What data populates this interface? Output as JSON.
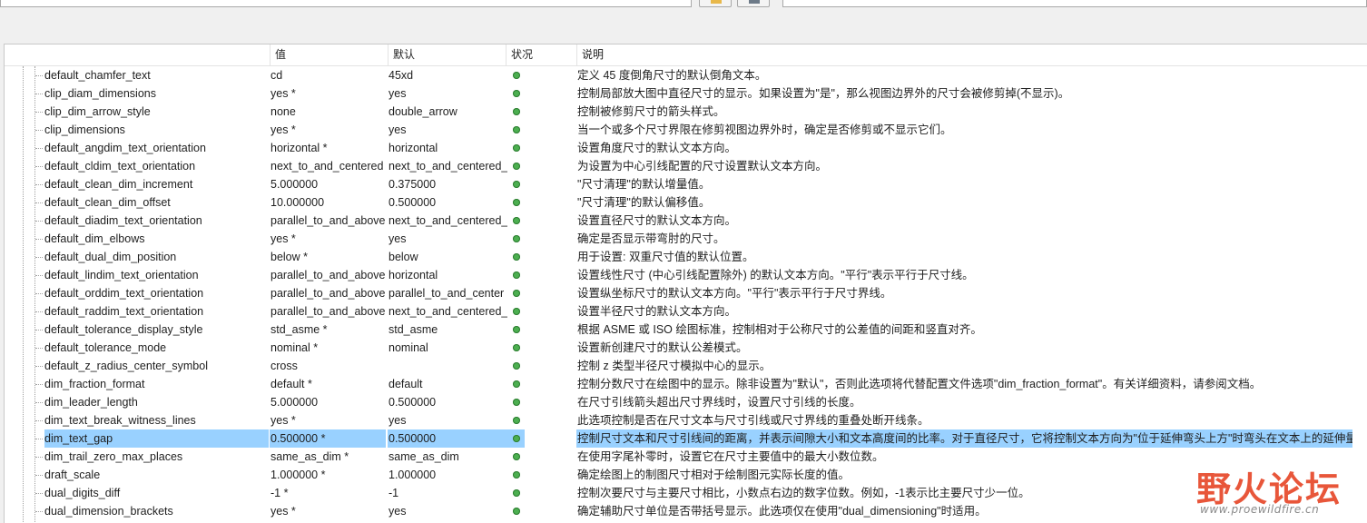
{
  "table": {
    "headers": {
      "name": "",
      "value": "值",
      "default": "默认",
      "status": "状况",
      "description": "说明"
    },
    "rows": [
      {
        "name": "default_chamfer_text",
        "value": "cd",
        "default": "45xd",
        "description": "定义 45 度倒角尺寸的默认倒角文本。"
      },
      {
        "name": "clip_diam_dimensions",
        "value": "yes *",
        "default": "yes",
        "description": "控制局部放大图中直径尺寸的显示。如果设置为\"是\"，那么视图边界外的尺寸会被修剪掉(不显示)。"
      },
      {
        "name": "clip_dim_arrow_style",
        "value": "none",
        "default": "double_arrow",
        "description": "控制被修剪尺寸的箭头样式。"
      },
      {
        "name": "clip_dimensions",
        "value": "yes *",
        "default": "yes",
        "description": "当一个或多个尺寸界限在修剪视图边界外时，确定是否修剪或不显示它们。"
      },
      {
        "name": "default_angdim_text_orientation",
        "value": "horizontal *",
        "default": "horizontal",
        "description": "设置角度尺寸的默认文本方向。"
      },
      {
        "name": "default_cldim_text_orientation",
        "value": "next_to_and_centered",
        "default": "next_to_and_centered_",
        "description": "为设置为中心引线配置的尺寸设置默认文本方向。"
      },
      {
        "name": "default_clean_dim_increment",
        "value": "5.000000",
        "default": "0.375000",
        "description": "\"尺寸清理\"的默认增量值。"
      },
      {
        "name": "default_clean_dim_offset",
        "value": "10.000000",
        "default": "0.500000",
        "description": "\"尺寸清理\"的默认偏移值。"
      },
      {
        "name": "default_diadim_text_orientation",
        "value": "parallel_to_and_above",
        "default": "next_to_and_centered_",
        "description": "设置直径尺寸的默认文本方向。"
      },
      {
        "name": "default_dim_elbows",
        "value": "yes *",
        "default": "yes",
        "description": "确定是否显示带弯肘的尺寸。"
      },
      {
        "name": "default_dual_dim_position",
        "value": "below *",
        "default": "below",
        "description": "用于设置: 双重尺寸值的默认位置。"
      },
      {
        "name": "default_lindim_text_orientation",
        "value": "parallel_to_and_above",
        "default": "horizontal",
        "description": "设置线性尺寸 (中心引线配置除外) 的默认文本方向。\"平行\"表示平行于尺寸线。"
      },
      {
        "name": "default_orddim_text_orientation",
        "value": "parallel_to_and_above",
        "default": "parallel_to_and_center",
        "description": "设置纵坐标尺寸的默认文本方向。\"平行\"表示平行于尺寸界线。"
      },
      {
        "name": "default_raddim_text_orientation",
        "value": "parallel_to_and_above",
        "default": "next_to_and_centered_",
        "description": "设置半径尺寸的默认文本方向。"
      },
      {
        "name": "default_tolerance_display_style",
        "value": "std_asme *",
        "default": "std_asme",
        "description": "根据 ASME 或 ISO 绘图标准，控制相对于公称尺寸的公差值的间距和竖直对齐。"
      },
      {
        "name": "default_tolerance_mode",
        "value": "nominal *",
        "default": "nominal",
        "description": "设置新创建尺寸的默认公差模式。"
      },
      {
        "name": "default_z_radius_center_symbol",
        "value": "cross",
        "default": "",
        "description": "控制 z 类型半径尺寸模拟中心的显示。"
      },
      {
        "name": "dim_fraction_format",
        "value": "default *",
        "default": "default",
        "description": "控制分数尺寸在绘图中的显示。除非设置为\"默认\"，否则此选项将代替配置文件选项\"dim_fraction_format\"。有关详细资料，请参阅文档。"
      },
      {
        "name": "dim_leader_length",
        "value": "5.000000",
        "default": "0.500000",
        "description": "在尺寸引线箭头超出尺寸界线时，设置尺寸引线的长度。"
      },
      {
        "name": "dim_text_break_witness_lines",
        "value": "yes *",
        "default": "yes",
        "description": "此选项控制是否在尺寸文本与尺寸引线或尺寸界线的重叠处断开线条。"
      },
      {
        "name": "dim_text_gap",
        "value": "0.500000 *",
        "default": "0.500000",
        "description": "控制尺寸文本和尺寸引线间的距离，并表示间隙大小和文本高度间的比率。对于直径尺寸，它将控制文本方向为\"位于延伸弯头上方\"时弯头在文本上的延伸量。",
        "selected": true
      },
      {
        "name": "dim_trail_zero_max_places",
        "value": "same_as_dim *",
        "default": "same_as_dim",
        "description": "在使用字尾补零时，设置它在尺寸主要值中的最大小数位数。"
      },
      {
        "name": "draft_scale",
        "value": "1.000000 *",
        "default": "1.000000",
        "description": "确定绘图上的制图尺寸相对于绘制图元实际长度的值。"
      },
      {
        "name": "dual_digits_diff",
        "value": "-1 *",
        "default": "-1",
        "description": "控制次要尺寸与主要尺寸相比，小数点右边的数字位数。例如，-1表示比主要尺寸少一位。"
      },
      {
        "name": "dual_dimension_brackets",
        "value": "yes *",
        "default": "yes",
        "description": "确定辅助尺寸单位是否带括号显示。此选项仅在使用\"dual_dimensioning\"时适用。"
      }
    ]
  },
  "status_color": "#4caf50",
  "selection_color": "#99d1ff",
  "watermark": {
    "title": "野火论坛",
    "url": "www.proewildfire.cn"
  }
}
